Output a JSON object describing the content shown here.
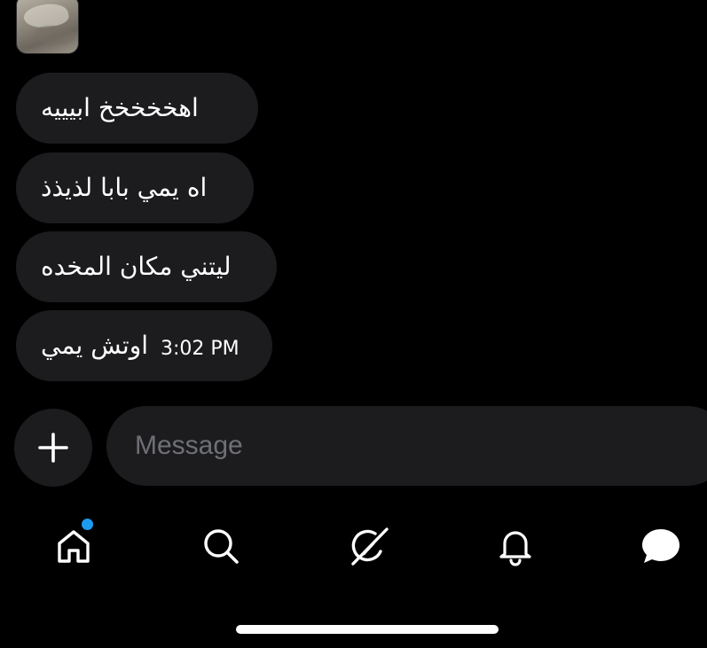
{
  "conversation": {
    "messages": [
      {
        "text": "اهخخخخخ ابيييه"
      },
      {
        "text": "اه يمي بابا لذيذذ"
      },
      {
        "text": "ليتني مكان المخده"
      },
      {
        "text": "اوتش يمي",
        "time": "3:02 PM"
      }
    ]
  },
  "composer": {
    "placeholder": "Message",
    "add_icon": "plus-icon"
  },
  "bottom_nav": {
    "items": [
      {
        "name": "home",
        "icon": "home-icon",
        "has_notification": true
      },
      {
        "name": "search",
        "icon": "search-icon"
      },
      {
        "name": "grok",
        "icon": "grok-icon"
      },
      {
        "name": "notifications",
        "icon": "bell-icon"
      },
      {
        "name": "messages",
        "icon": "chat-bubble-icon",
        "active": true
      }
    ]
  },
  "colors": {
    "background": "#000000",
    "bubble": "#1c1c1e",
    "placeholder": "#6e7076",
    "accent": "#1d9bf0",
    "text": "#ffffff"
  }
}
